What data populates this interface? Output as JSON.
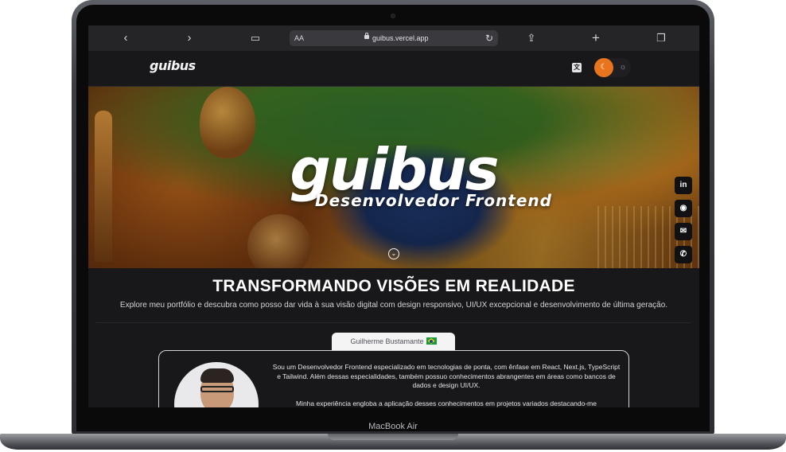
{
  "browser": {
    "url_prefix": "AA",
    "url": "guibus.vercel.app"
  },
  "site": {
    "logo": "guibus",
    "translate_label": "文A",
    "theme": {
      "active": "dark"
    }
  },
  "hero": {
    "logo": "guibus",
    "subtitle": "Desenvolvedor Frontend"
  },
  "social": [
    {
      "name": "linkedin",
      "glyph": "in"
    },
    {
      "name": "github",
      "glyph": "◉"
    },
    {
      "name": "contact",
      "glyph": "✉"
    },
    {
      "name": "whatsapp",
      "glyph": "✆"
    }
  ],
  "main": {
    "headline": "TRANSFORMANDO VISÕES EM REALIDADE",
    "subline": "Explore meu portfólio e descubra como posso dar vida à sua visão digital com design responsivo, UI/UX excepcional e desenvolvimento de última geração."
  },
  "profile": {
    "name": "Guilherme Bustamante",
    "bio_1": "Sou um Desenvolvedor Frontend especializado em tecnologias de ponta, com ênfase em React, Next.js, TypeScript e Tailwind. Além dessas especialidades, também possuo conhecimentos abrangentes em áreas como bancos de dados e design UI/UX.",
    "bio_2": "Minha experiência engloba a aplicação desses conhecimentos em projetos variados destacando-me"
  },
  "device": {
    "model": "MacBook Air"
  }
}
